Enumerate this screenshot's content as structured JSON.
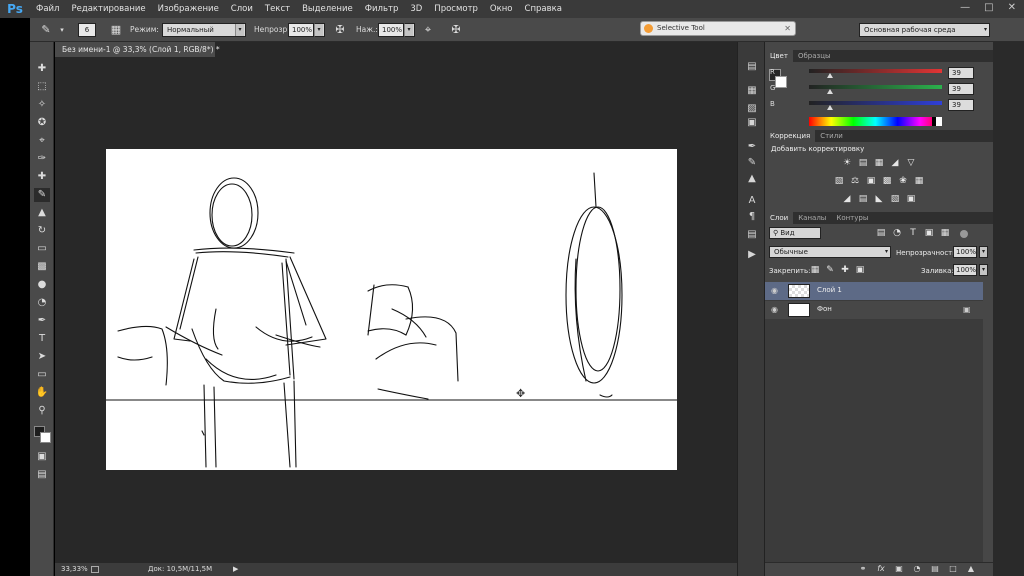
{
  "app": {
    "logo": "Ps"
  },
  "menu": [
    "Файл",
    "Редактирование",
    "Изображение",
    "Слои",
    "Текст",
    "Выделение",
    "Фильтр",
    "3D",
    "Просмотр",
    "Окно",
    "Справка"
  ],
  "options": {
    "brush_size": "6",
    "mode_label": "Режим:",
    "mode_value": "Нормальный",
    "opacity_label": "Непрозр.:",
    "opacity_value": "100%",
    "flow_label": "Наж.:",
    "flow_value": "100%",
    "selective_tool": "Selective Tool",
    "workspace": "Основная рабочая среда"
  },
  "document": {
    "tab_title": "Без имени-1 @ 33,3% (Слой 1, RGB/8*) *",
    "zoom": "33,33%",
    "doc_info": "Док: 10,5M/11,5M"
  },
  "color_panel": {
    "tabs": [
      "Цвет",
      "Образцы"
    ],
    "channels": [
      {
        "label": "R",
        "value": "39"
      },
      {
        "label": "G",
        "value": "39"
      },
      {
        "label": "B",
        "value": "39"
      }
    ],
    "colors": {
      "foreground": "#272727",
      "background": "#ffffff",
      "r_track": "#e23434",
      "g_track": "#2bb24c",
      "b_track": "#2f3fd8"
    }
  },
  "adjustments_panel": {
    "tabs": [
      "Коррекция",
      "Стили"
    ],
    "heading": "Добавить корректировку",
    "icons": [
      "brightness-icon",
      "levels-icon",
      "curves-icon",
      "exposure-icon",
      "vibrance-icon",
      "hue-saturation-icon",
      "color-balance-icon",
      "black-white-icon",
      "photo-filter-icon",
      "channel-mixer-icon",
      "color-lookup-icon",
      "invert-icon",
      "posterize-icon",
      "threshold-icon",
      "gradient-map-icon",
      "selective-color-icon"
    ]
  },
  "layers_panel": {
    "tabs": [
      "Слои",
      "Каналы",
      "Контуры"
    ],
    "filter_kind": "Вид",
    "blend_mode": "Обычные",
    "opacity_label": "Непрозрачность:",
    "opacity_value": "100%",
    "lock_label": "Закрепить:",
    "fill_label": "Заливка:",
    "fill_value": "100%",
    "layers": [
      {
        "name": "Слой 1",
        "selected": true
      },
      {
        "name": "Фон",
        "selected": false,
        "locked": true
      }
    ]
  }
}
